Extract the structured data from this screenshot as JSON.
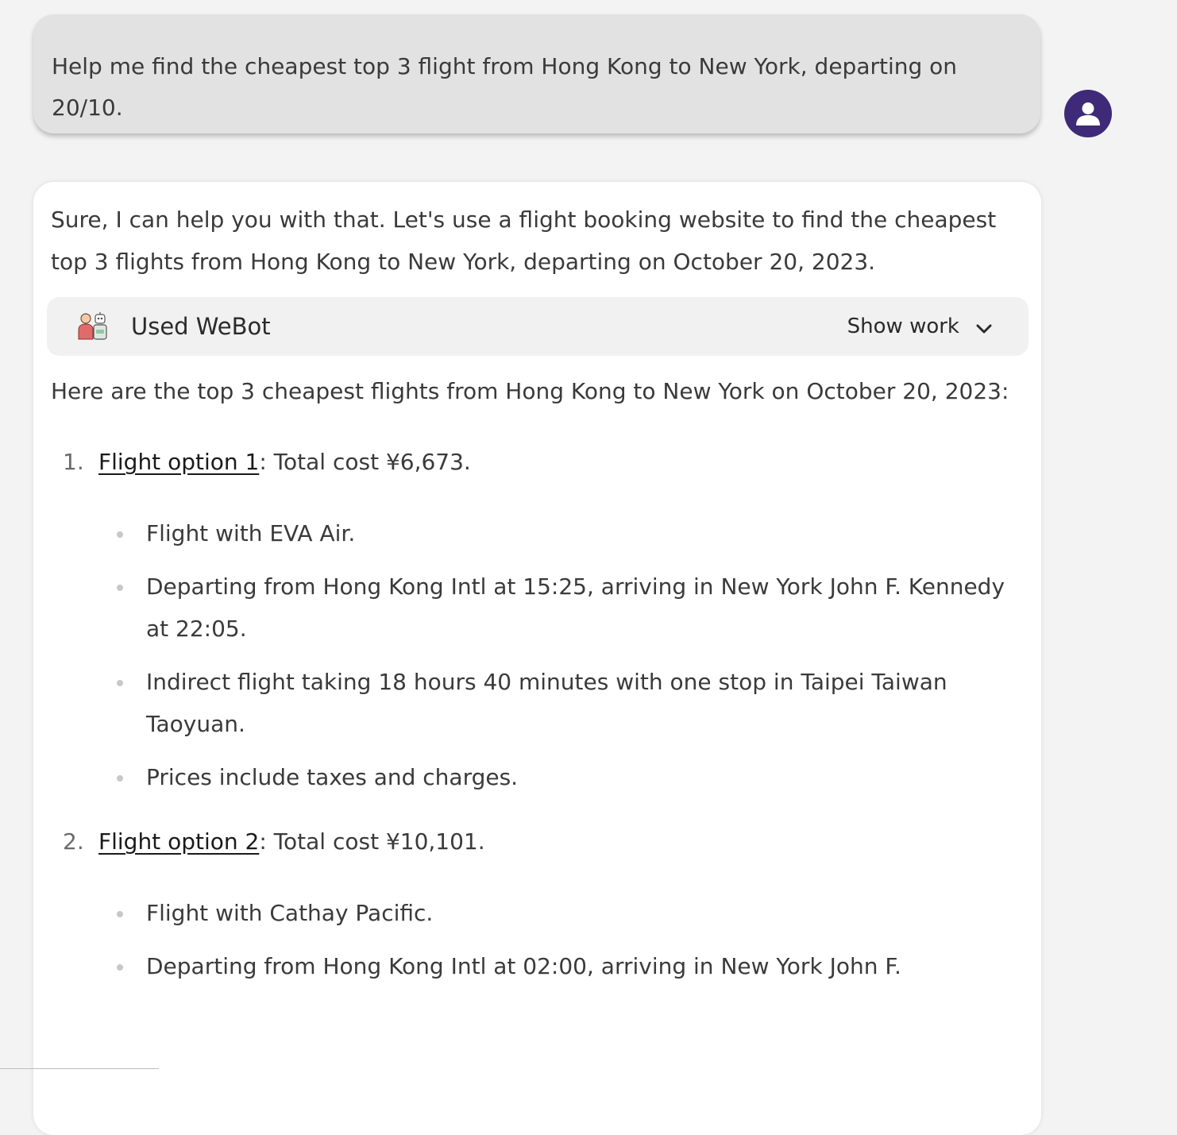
{
  "user_message": {
    "text": "Help me find the cheapest top 3 flight from Hong Kong to New York, departing on 20/10."
  },
  "assistant_message": {
    "intro": "Sure, I can help you with that. Let's use a flight booking website to find the cheapest top 3 flights from Hong Kong to New York, departing on October 20, 2023.",
    "tool": {
      "icon": "webot-plugin-icon",
      "label": "Used WeBot",
      "show_work_label": "Show work"
    },
    "summary": "Here are the top 3 cheapest flights from Hong Kong to New York on October 20, 2023:",
    "options": [
      {
        "number": "1.",
        "link_text": "Flight option 1",
        "cost_text": ": Total cost ¥6,673.",
        "details": [
          "Flight with EVA Air.",
          "Departing from Hong Kong Intl at 15:25, arriving in New York John F. Kennedy at 22:05.",
          "Indirect flight taking 18 hours 40 minutes with one stop in Taipei Taiwan Taoyuan.",
          "Prices include taxes and charges."
        ]
      },
      {
        "number": "2.",
        "link_text": "Flight option 2",
        "cost_text": ": Total cost ¥10,101.",
        "details": [
          "Flight with Cathay Pacific.",
          "Departing from Hong Kong Intl at 02:00, arriving in New York John F."
        ]
      }
    ]
  },
  "colors": {
    "page_bg": "#f3f3f3",
    "user_bubble": "#e2e2e2",
    "assistant_bubble": "#ffffff",
    "avatar": "#3e2a79",
    "tool_bar": "#f1f1f1"
  }
}
